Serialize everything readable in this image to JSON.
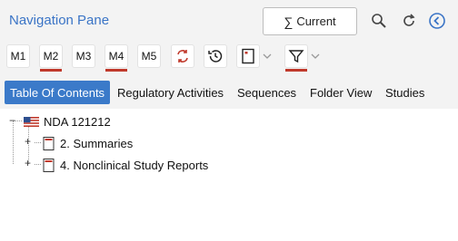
{
  "header": {
    "title": "Navigation Pane",
    "current_label": "Current"
  },
  "toolbar": {
    "modules": [
      "M1",
      "M2",
      "M3",
      "M4",
      "M5"
    ]
  },
  "tabs": [
    "Table Of Contents",
    "Regulatory Activities",
    "Sequences",
    "Folder View",
    "Studies"
  ],
  "tree": {
    "root": "NDA 121212",
    "children": [
      "2. Summaries",
      "4. Nonclinical Study Reports"
    ]
  },
  "colors": {
    "accent": "#3a74c6",
    "tab_selected": "#3b7ac9",
    "underline": "#c0392b"
  }
}
